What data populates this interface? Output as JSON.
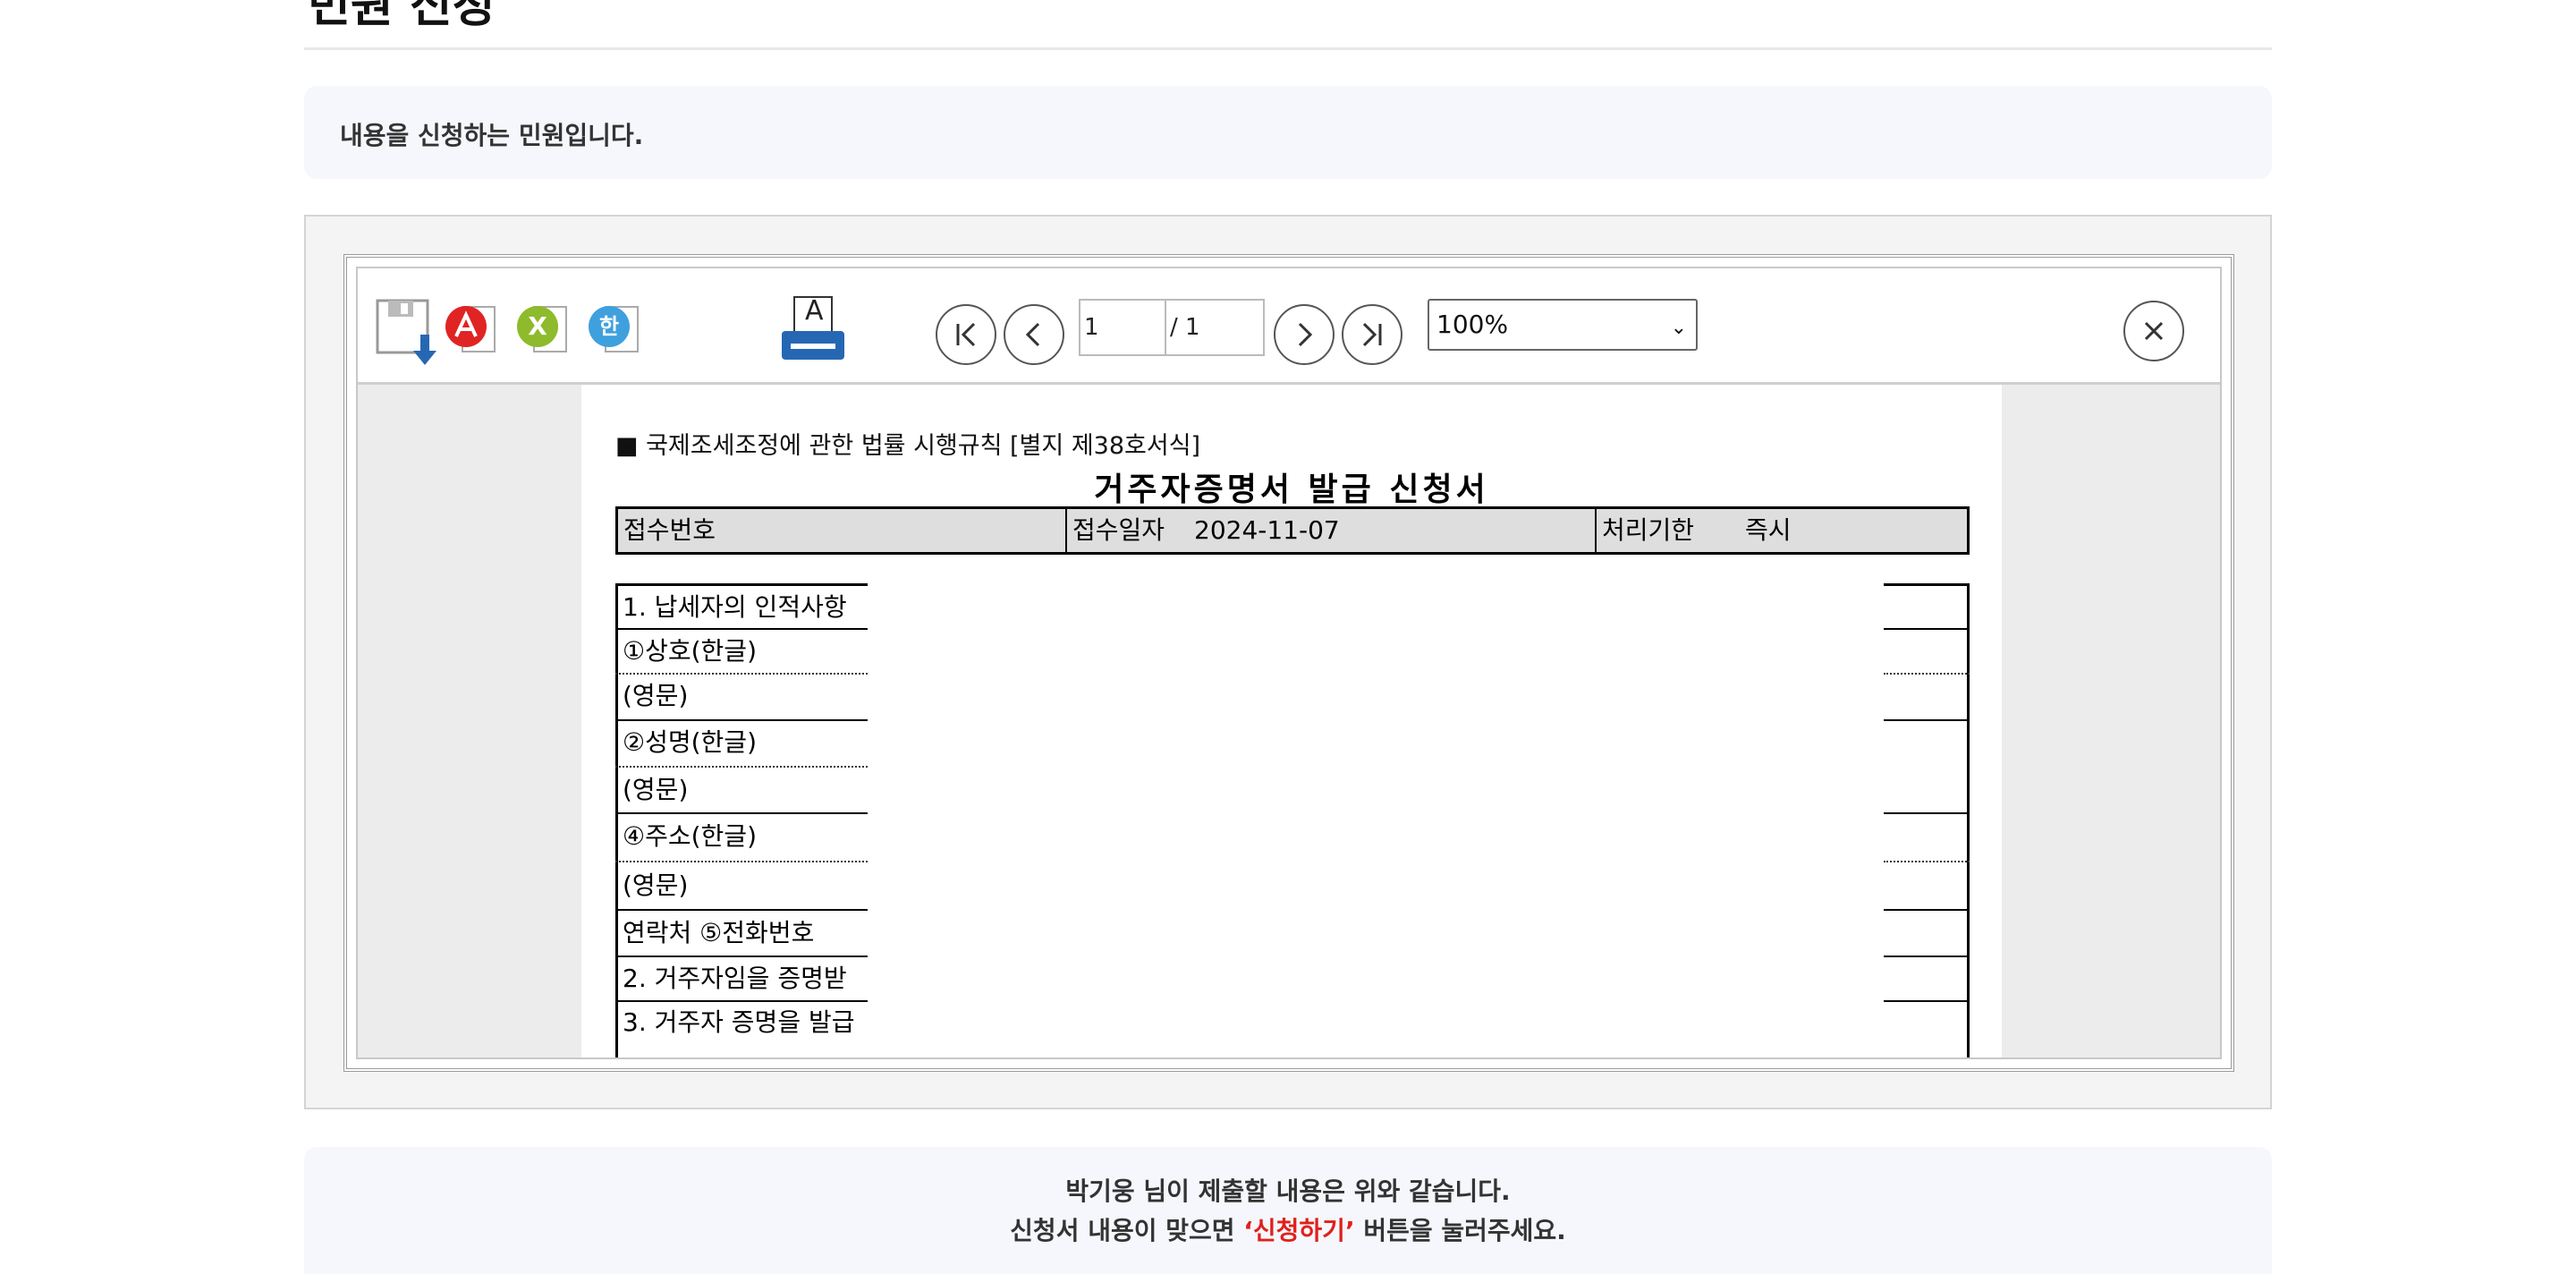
{
  "header": {
    "title": "민원 신청"
  },
  "intro": {
    "text": "내용을 신청하는 민원입니다."
  },
  "viewer": {
    "toolbar": {
      "save_icon": "save-icon",
      "pdf_icon": "pdf-icon",
      "excel_icon": "excel-icon",
      "hwp_icon": "hwp-icon",
      "print_icon": "print-icon",
      "print_letter": "A",
      "excel_letter": "X",
      "hwp_letter": "한",
      "current_page": "1",
      "total_pages": "/ 1",
      "zoom": "100%",
      "zoom_options": [
        "100%"
      ]
    },
    "document": {
      "form_ref": "■ 국제조세조정에 관한 법률 시행규칙 [별지 제38호서식]",
      "title": "거주자증명서 발급 신청서",
      "receipt_label": "접수번호",
      "receipt_date_label": "접수일자",
      "receipt_date": "2024-11-07",
      "deadline_label": "처리기한",
      "deadline_value": "즉시",
      "rows": [
        "1.  납세자의 인적사항",
        "①상호(한글)",
        "        (영문)",
        "②성명(한글)",
        "        (영문)",
        "④주소(한글)",
        "        (영문)",
        "연락처     ⑤전화번호",
        "2.  거주자임을 증명받",
        "3.  거주자 증명을 발급"
      ]
    }
  },
  "footer": {
    "line1": "박기웅 님이 제출할 내용은 위와 같습니다.",
    "line2_prefix": "신청서 내용이 맞으면 ",
    "line2_highlight": "‘신청하기’",
    "line2_suffix": " 버튼을 눌러주세요."
  }
}
